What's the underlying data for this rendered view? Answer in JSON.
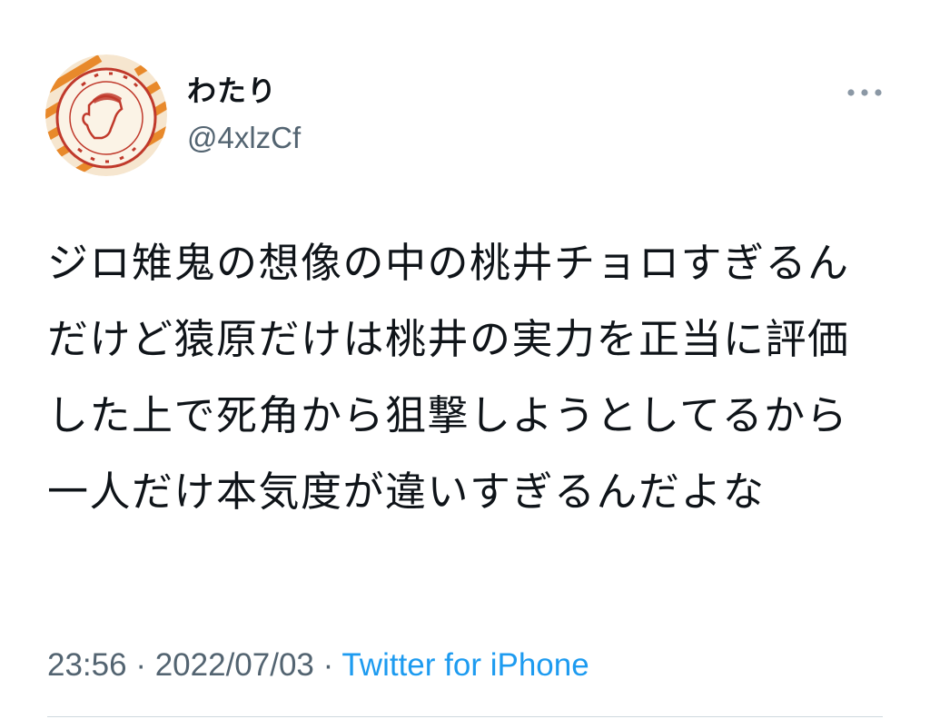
{
  "user": {
    "display_name": "わたり",
    "handle": "@4xlzCf",
    "avatar_icon": "mister-gyoza-logo-avatar"
  },
  "tweet": {
    "text": "ジロ雉鬼の想像の中の桃井チョロすぎるんだけど猿原だけは桃井の実力を正当に評価した上で死角から狙撃しようとしてるから一人だけ本気度が違いすぎるんだよな",
    "time": "23:56",
    "separator": " · ",
    "date": "2022/07/03",
    "source": "Twitter for iPhone"
  },
  "icons": {
    "more": "more-options-icon"
  },
  "colors": {
    "text": "#0f1419",
    "secondary": "#536471",
    "link": "#1d9bf0",
    "avatar_orange": "#e8892b",
    "avatar_red": "#c0392b"
  }
}
